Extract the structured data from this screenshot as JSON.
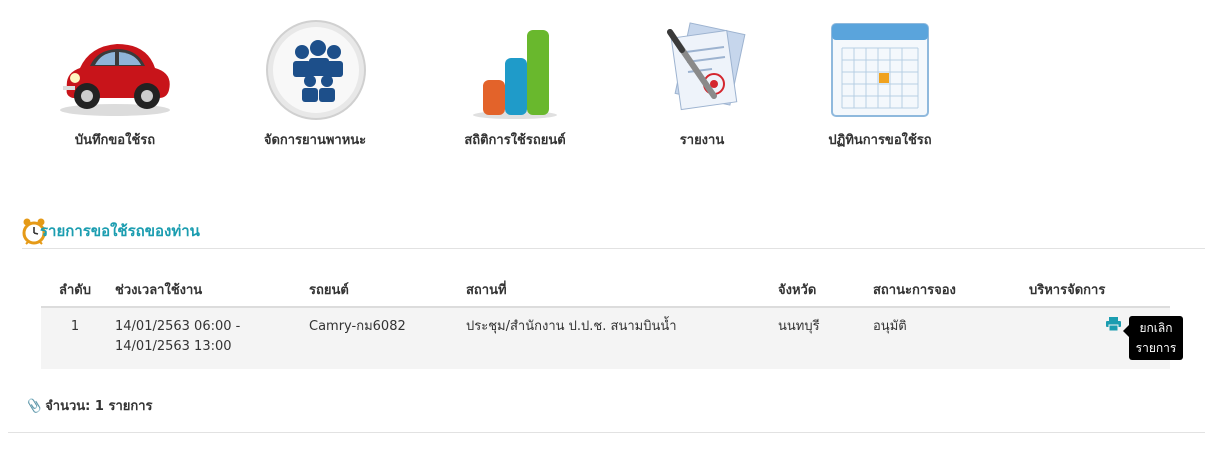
{
  "menu": [
    {
      "label": "บันทึกขอใช้รถ",
      "icon": "car-icon"
    },
    {
      "label": "จัดการยานพาหนะ",
      "icon": "users-icon"
    },
    {
      "label": "สถิติการใช้รถยนต์",
      "icon": "bar-chart-icon"
    },
    {
      "label": "รายงาน",
      "icon": "report-document-icon"
    },
    {
      "label": "ปฏิทินการขอใช้รถ",
      "icon": "calendar-icon"
    }
  ],
  "section": {
    "title": "รายการขอใช้รถของท่าน",
    "icon": "alarm-clock-icon"
  },
  "table": {
    "headers": [
      "ลำดับ",
      "ช่วงเวลาใช้งาน",
      "รถยนต์",
      "สถานที่",
      "จังหวัด",
      "สถานะการจอง",
      "บริหารจัดการ"
    ],
    "rows": [
      {
        "no": "1",
        "time_start": "14/01/2563 06:00 -",
        "time_end": "14/01/2563 13:00",
        "car": "Camry-กม6082",
        "place": "ประชุม/สำนักงาน ป.ป.ช. สนามบินน้ำ",
        "province": "นนทบุรี",
        "status": "อนุมัติ"
      }
    ]
  },
  "tooltip": {
    "line1": "ยกเลิก",
    "line2": "รายการ"
  },
  "count": {
    "text": "จำนวน: 1 รายการ"
  },
  "colors": {
    "accent": "#1b9db0",
    "print": "#1b9db0",
    "delete": "#e0191d"
  }
}
